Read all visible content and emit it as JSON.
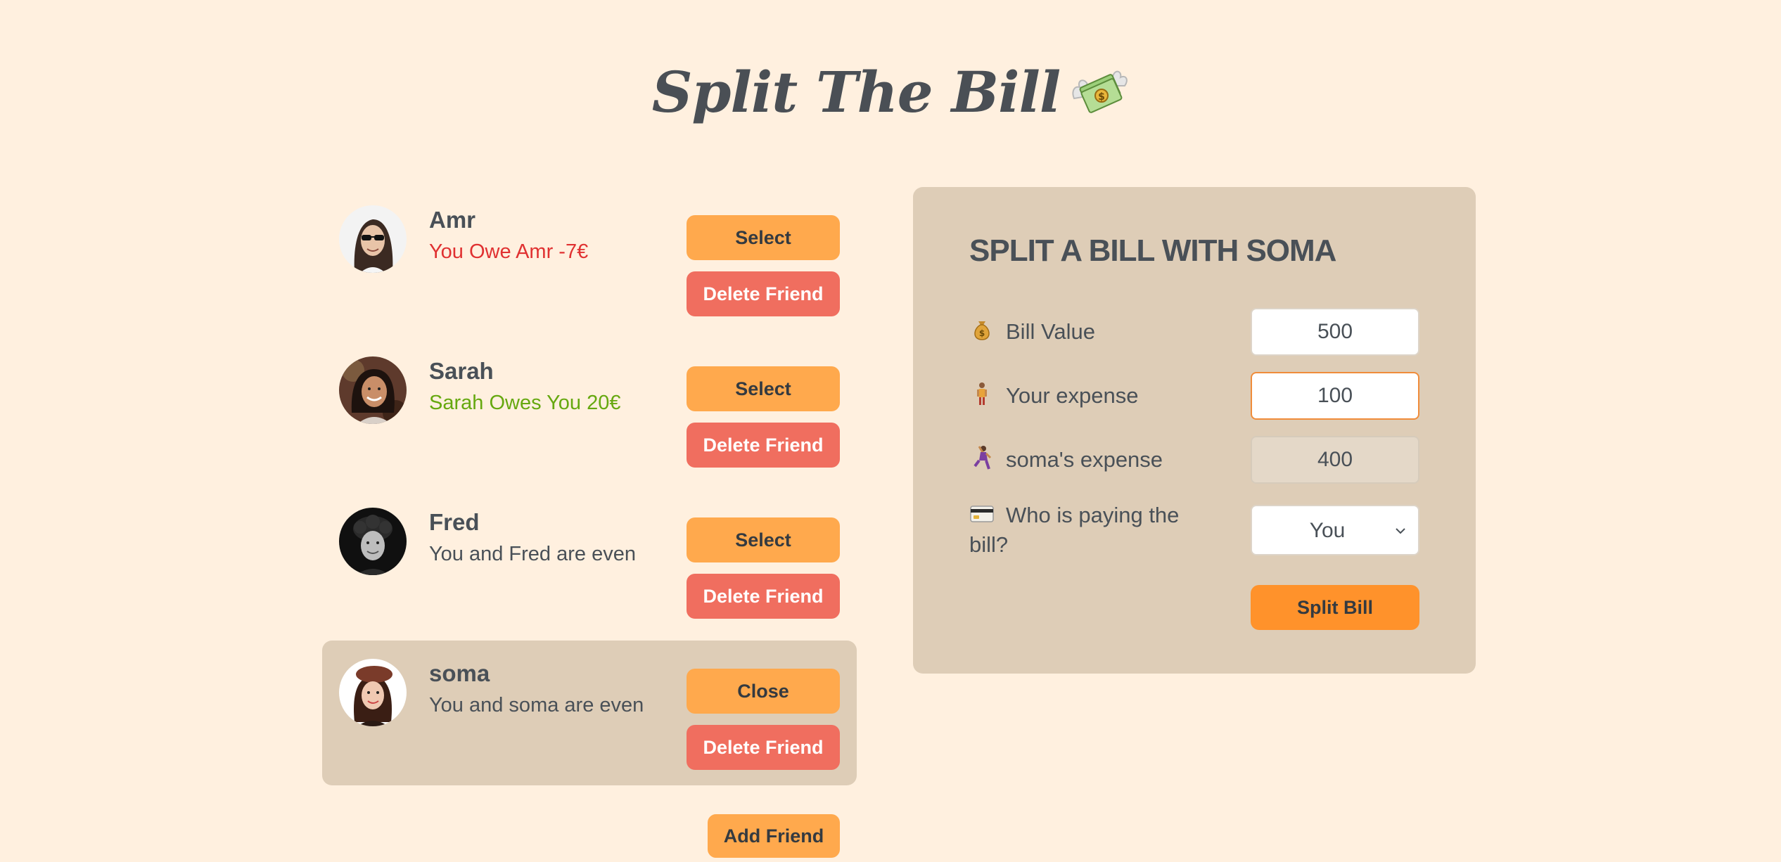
{
  "app": {
    "title": "Split The Bill",
    "title_icon": "money-with-wings-icon"
  },
  "friends": [
    {
      "name": "Amr",
      "status": "You Owe Amr -7€",
      "status_tone": "red",
      "select_label": "Select",
      "delete_label": "Delete Friend",
      "selected": false
    },
    {
      "name": "Sarah",
      "status": "Sarah Owes You 20€",
      "status_tone": "green",
      "select_label": "Select",
      "delete_label": "Delete Friend",
      "selected": false
    },
    {
      "name": "Fred",
      "status": "You and Fred are even",
      "status_tone": "neutral",
      "select_label": "Select",
      "delete_label": "Delete Friend",
      "selected": false
    },
    {
      "name": "soma",
      "status": "You and soma are even",
      "status_tone": "neutral",
      "select_label": "Close",
      "delete_label": "Delete Friend",
      "selected": true
    }
  ],
  "add_friend_label": "Add Friend",
  "split_form": {
    "title": "SPLIT A BILL WITH SOMA",
    "bill_value": {
      "label": "Bill Value",
      "icon": "money-bag-icon",
      "value": "500"
    },
    "your_expense": {
      "label": "Your expense",
      "icon": "person-standing-icon",
      "value": "100"
    },
    "friend_expense": {
      "label": "soma's expense",
      "icon": "woman-dancing-icon",
      "value": "400"
    },
    "payer": {
      "label": "Who is paying the bill?",
      "icon": "credit-card-icon",
      "value": "You"
    },
    "submit_label": "Split Bill"
  },
  "colors": {
    "background": "#fff0df",
    "panel": "#decdb7",
    "button_primary": "#ffa94d",
    "button_danger": "#f06e5f",
    "owe_red": "#e03131",
    "owed_green": "#66a80f"
  }
}
